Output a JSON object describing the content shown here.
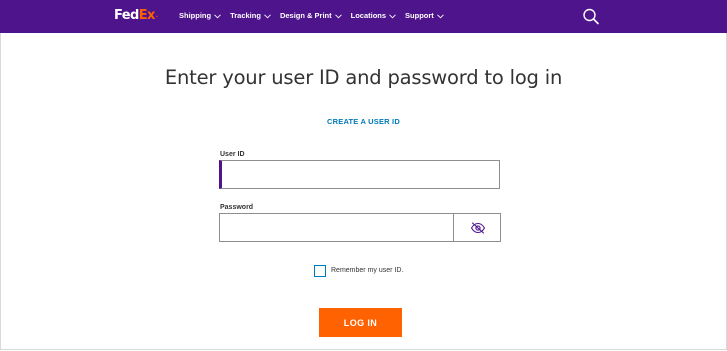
{
  "header": {
    "logo": {
      "part1": "Fed",
      "part2": "Ex",
      "suffix": "."
    },
    "nav": [
      {
        "label": "Shipping",
        "icon": "chevron-down-icon"
      },
      {
        "label": "Tracking",
        "icon": "chevron-down-icon"
      },
      {
        "label": "Design & Print",
        "icon": "chevron-down-icon"
      },
      {
        "label": "Locations",
        "icon": "chevron-down-icon"
      },
      {
        "label": "Support",
        "icon": "chevron-down-icon"
      }
    ],
    "search_icon": "search-icon"
  },
  "login": {
    "title": "Enter your user ID and password to log in",
    "create_link": "CREATE A USER ID",
    "userid": {
      "label": "User ID",
      "value": "",
      "placeholder": ""
    },
    "password": {
      "label": "Password",
      "value": "",
      "placeholder": "",
      "toggle_icon": "eye-slash-icon"
    },
    "remember": {
      "label": "Remember my user ID.",
      "checked": false
    },
    "submit_label": "LOG IN"
  },
  "colors": {
    "brand_purple": "#4d148c",
    "brand_orange": "#ff6200",
    "link_blue": "#007ab7",
    "text": "#333333",
    "input_border": "#8e8e8e"
  }
}
